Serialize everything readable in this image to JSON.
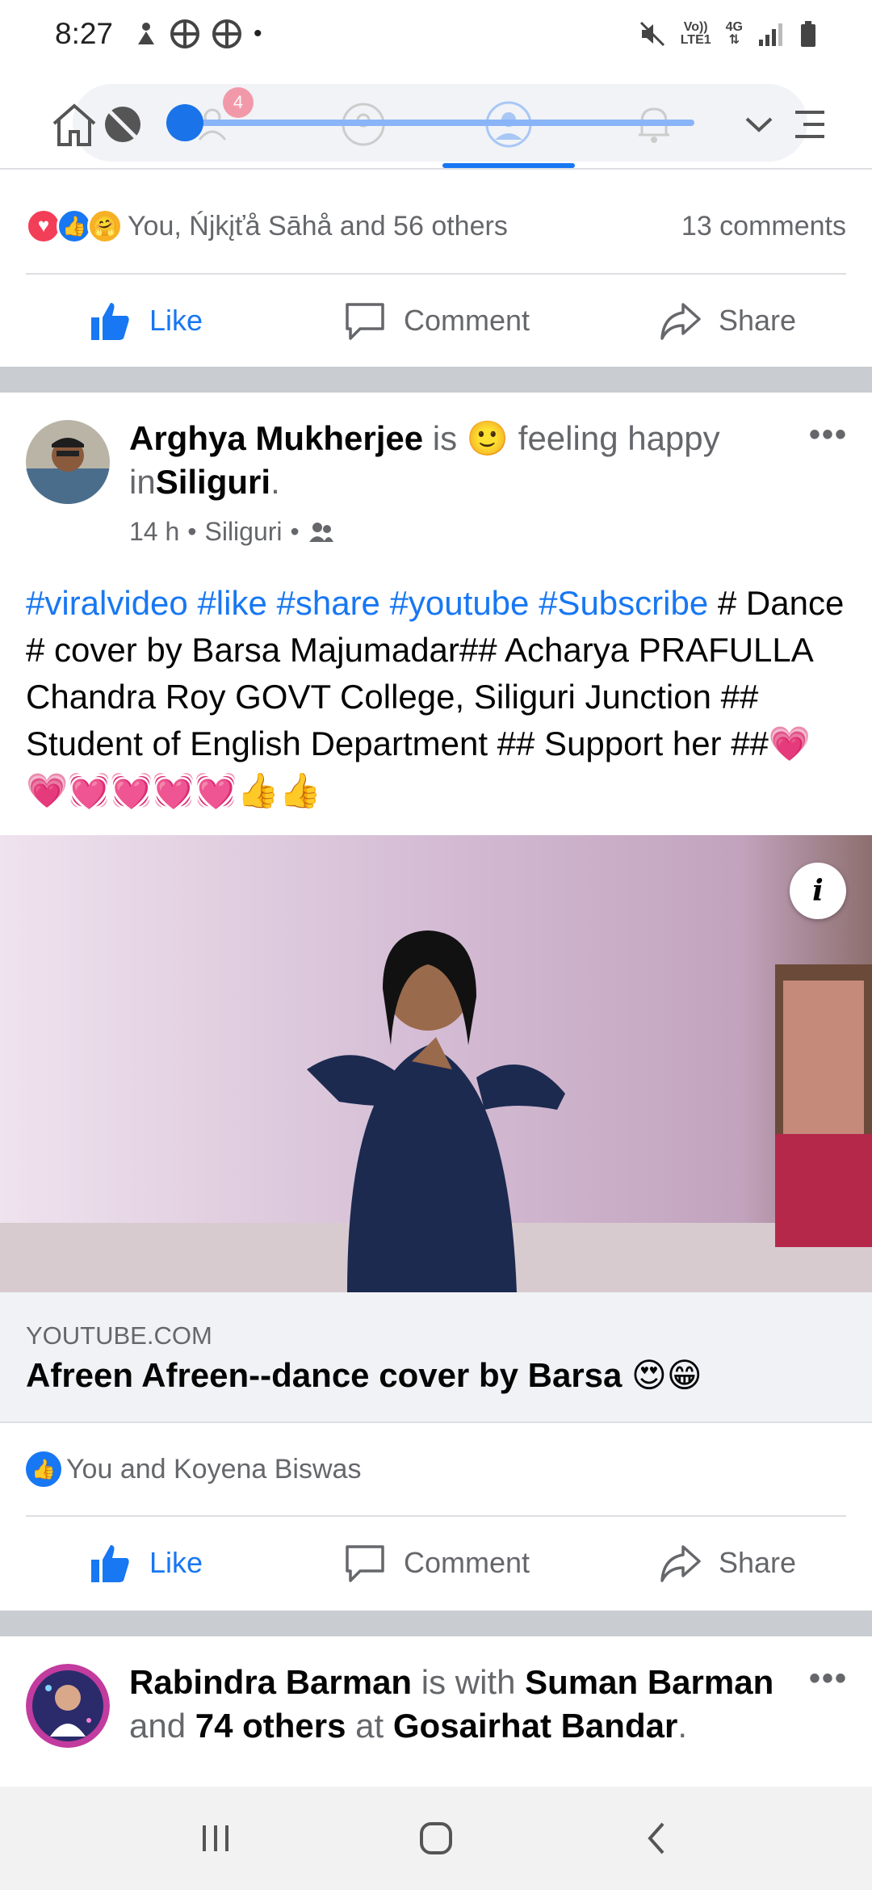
{
  "status_bar": {
    "time": "8:27",
    "signal_top": "Vo))",
    "signal_bottom": "LTE1",
    "network": "4G"
  },
  "post1": {
    "reaction_text": "You, Ńjkįťå Sāhå and 56 others",
    "comments": "13 comments",
    "like_label": "Like",
    "comment_label": "Comment",
    "share_label": "Share"
  },
  "post2": {
    "author": "Arghya Mukherjee",
    "is_text": "is",
    "emoji": "🙂",
    "feeling": "feeling happy",
    "in_text": "in",
    "location": "Siliguri",
    "dot_end": ".",
    "time": "14 h",
    "meta_location": "Siliguri",
    "hashtags": "#viralvideo #like #share #youtube #Subscribe",
    "body": " # Dance #  cover by Barsa Majumadar## Acharya PRAFULLA Chandra Roy GOVT College, Siliguri Junction ## Student of English Department ## Support her ##💗💗💓💓💓💓👍👍",
    "link_domain": "YOUTUBE.COM",
    "link_title": "Afreen Afreen--dance cover by Barsa 😍😁",
    "likes_text": "You and Koyena Biswas",
    "like_label": "Like",
    "comment_label": "Comment",
    "share_label": "Share"
  },
  "post3": {
    "author": "Rabindra Barman",
    "is_with": "is with",
    "tagged": "Suman Barman",
    "and_text": "and",
    "others": "74 others",
    "at_text": "at",
    "place": "Gosairhat Bandar",
    "dot_end": "."
  },
  "colors": {
    "accent": "#1877f2",
    "secondary_text": "#65676b",
    "separator": "#c9ccd1"
  }
}
